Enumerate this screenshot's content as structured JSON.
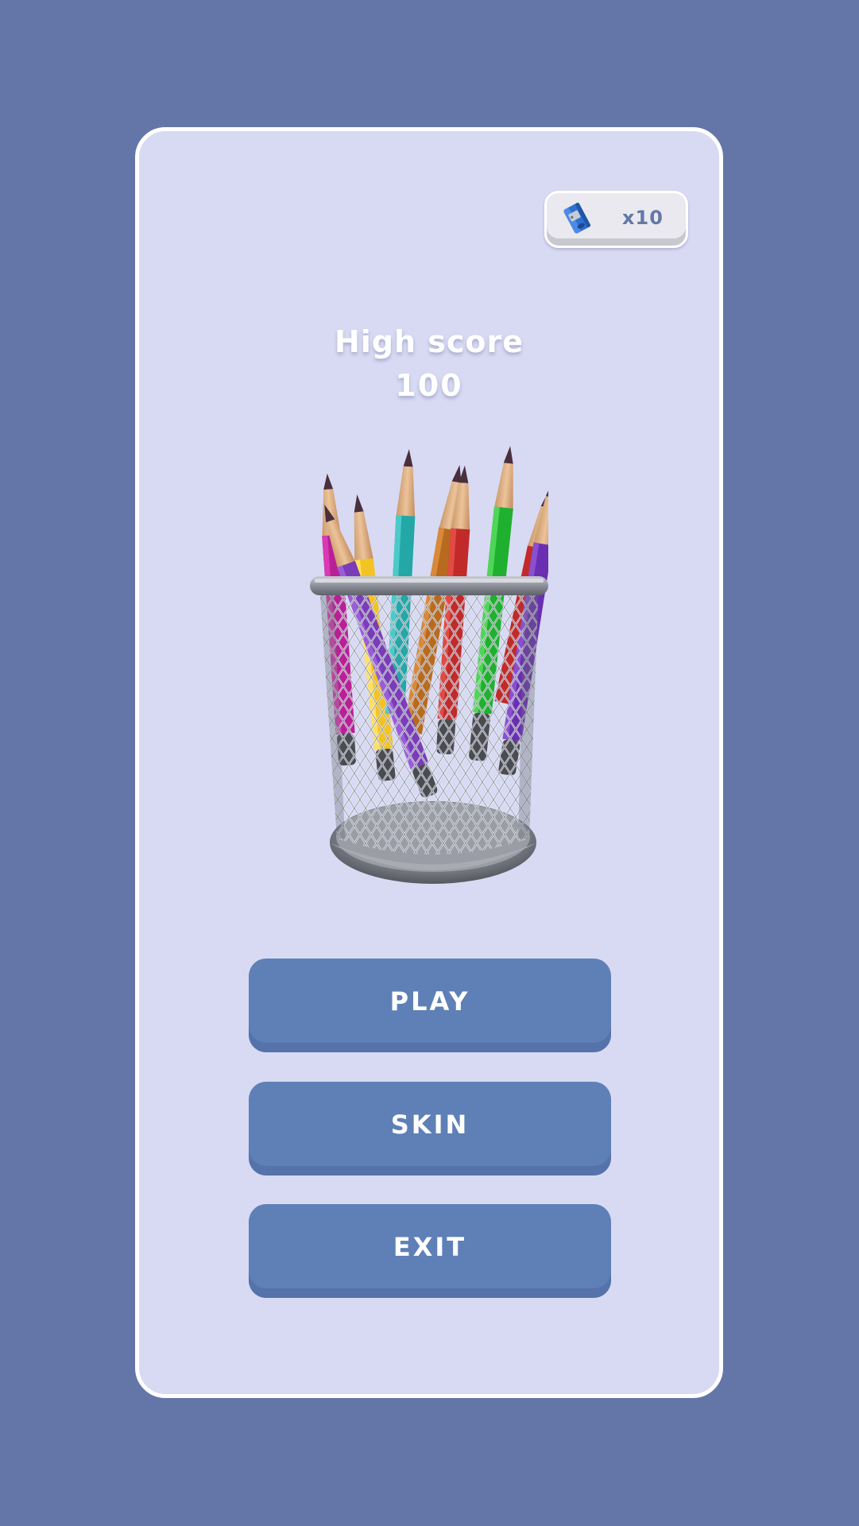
{
  "colors": {
    "background": "#6475a8",
    "panel": "#d8daf3",
    "button": "#5e80b6",
    "counter_text": "#6378a8"
  },
  "currency": {
    "icon": "pencil-sharpener-icon",
    "count": "x10"
  },
  "high_score": {
    "label": "High score",
    "value": "100"
  },
  "buttons": {
    "play": "PLAY",
    "skin": "SKIN",
    "exit": "EXIT"
  }
}
